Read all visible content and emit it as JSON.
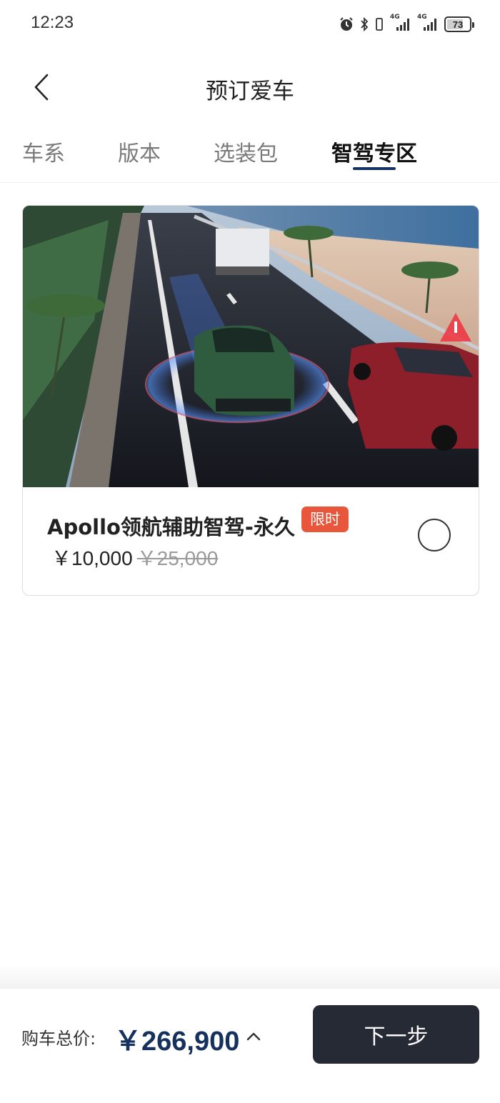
{
  "status_bar": {
    "time": "12:23",
    "battery_level": "73",
    "network_1": "4G",
    "network_2": "4G",
    "icons": [
      "alarm-icon",
      "bluetooth-icon",
      "vibrate-icon",
      "signal-icon",
      "signal-icon",
      "battery-icon"
    ]
  },
  "header": {
    "back_icon": "chevron-left-icon",
    "title": "预订爱车"
  },
  "tabs": [
    {
      "label": "车系",
      "active": false
    },
    {
      "label": "版本",
      "active": false
    },
    {
      "label": "选装包",
      "active": false
    },
    {
      "label": "智驾专区",
      "active": true
    }
  ],
  "option_card": {
    "image_alt": "highway-driving-assist-illustration",
    "name": "Apollo领航辅助智驾-永久",
    "badge": "限时",
    "price_current": "￥10,000",
    "price_original": "￥25,000",
    "selected": false
  },
  "footer": {
    "total_label": "购车总价:",
    "total_price": "￥266,900",
    "expand_icon": "chevron-up-icon",
    "next_label": "下一步"
  },
  "colors": {
    "accent": "#17315e",
    "badge": "#e8573b",
    "button_dark": "#252a35"
  }
}
